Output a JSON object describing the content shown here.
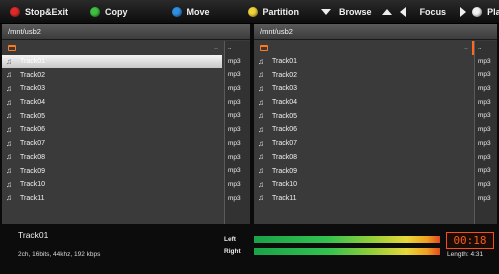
{
  "toolbar": {
    "stop_exit": "Stop&Exit",
    "copy": "Copy",
    "move": "Move",
    "partition": "Partition",
    "browse": "Browse",
    "focus": "Focus",
    "play": "Play",
    "colors": {
      "red": "#e02a2a",
      "green": "#3fbf3f",
      "blue": "#2f8fe0",
      "yellow": "#f0d23a",
      "white": "#f2f2f2"
    }
  },
  "left_pane": {
    "path": "/mnt/usb2",
    "up_dots": "..",
    "up_type": "..",
    "selected_index": 0,
    "tracks": [
      {
        "name": "Track01",
        "type": "mp3"
      },
      {
        "name": "Track02",
        "type": "mp3"
      },
      {
        "name": "Track03",
        "type": "mp3"
      },
      {
        "name": "Track04",
        "type": "mp3"
      },
      {
        "name": "Track05",
        "type": "mp3"
      },
      {
        "name": "Track06",
        "type": "mp3"
      },
      {
        "name": "Track07",
        "type": "mp3"
      },
      {
        "name": "Track08",
        "type": "mp3"
      },
      {
        "name": "Track09",
        "type": "mp3"
      },
      {
        "name": "Track10",
        "type": "mp3"
      },
      {
        "name": "Track11",
        "type": "mp3"
      }
    ]
  },
  "right_pane": {
    "path": "/mnt/usb2",
    "up_dots": "..",
    "up_type": "..",
    "tracks": [
      {
        "name": "Track01",
        "type": "mp3"
      },
      {
        "name": "Track02",
        "type": "mp3"
      },
      {
        "name": "Track03",
        "type": "mp3"
      },
      {
        "name": "Track04",
        "type": "mp3"
      },
      {
        "name": "Track05",
        "type": "mp3"
      },
      {
        "name": "Track06",
        "type": "mp3"
      },
      {
        "name": "Track07",
        "type": "mp3"
      },
      {
        "name": "Track08",
        "type": "mp3"
      },
      {
        "name": "Track09",
        "type": "mp3"
      },
      {
        "name": "Track10",
        "type": "mp3"
      },
      {
        "name": "Track11",
        "type": "mp3"
      }
    ]
  },
  "status": {
    "now_playing": "Track01",
    "info": "2ch, 16bits, 44khz, 192 kbps",
    "left_label": "Left",
    "right_label": "Right",
    "left_level": 0.98,
    "right_level": 0.98,
    "elapsed": "00:18",
    "length": "Length: 4:31"
  }
}
